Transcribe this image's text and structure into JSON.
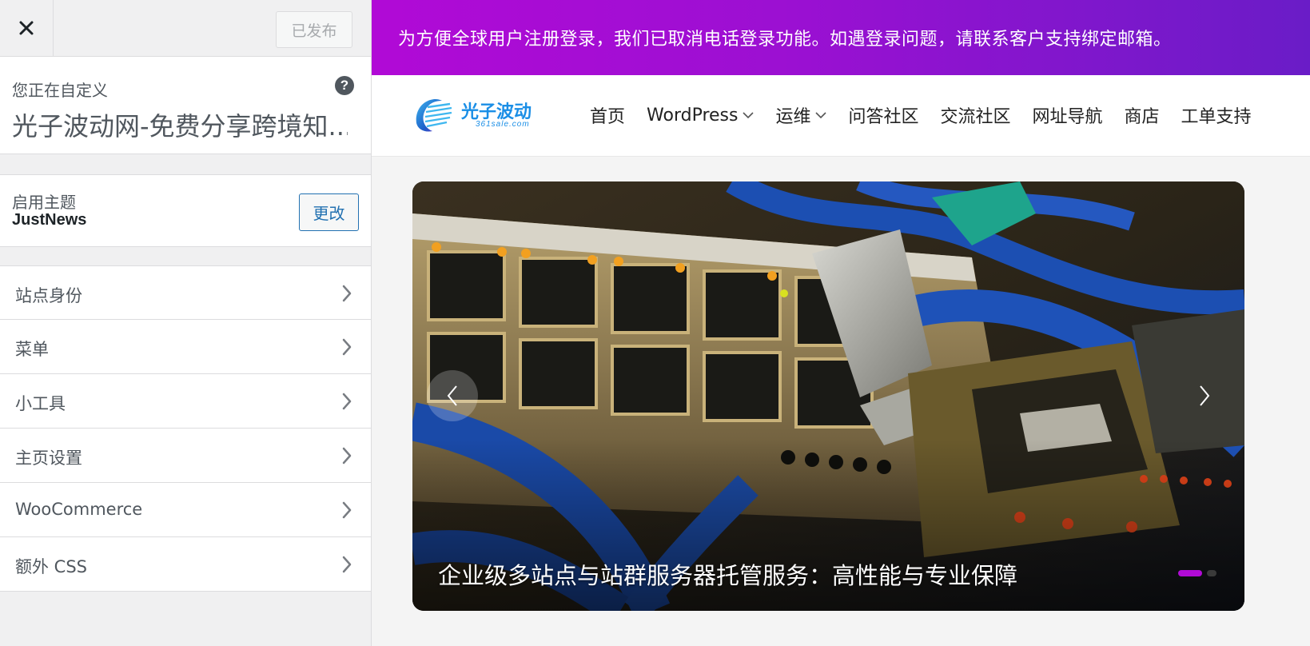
{
  "sidebar": {
    "publish_label": "已发布",
    "customizing_label": "您正在自定义",
    "site_title": "光子波动网-免费分享跨境知...",
    "active_theme_label": "启用主题",
    "active_theme_name": "JustNews",
    "change_label": "更改",
    "items": [
      {
        "label": "站点身份"
      },
      {
        "label": "菜单"
      },
      {
        "label": "小工具"
      },
      {
        "label": "主页设置"
      },
      {
        "label": "WooCommerce"
      },
      {
        "label": "额外 CSS"
      }
    ]
  },
  "preview": {
    "notice_text": "为方便全球用户注册登录，我们已取消电话登录功能。如遇登录问题，请联系客户支持绑定邮箱。",
    "logo_text": "光子波动",
    "logo_subtext": "361sale.com",
    "nav": [
      {
        "label": "首页",
        "has_dropdown": false
      },
      {
        "label": "WordPress",
        "has_dropdown": true
      },
      {
        "label": "运维",
        "has_dropdown": true
      },
      {
        "label": "问答社区",
        "has_dropdown": false
      },
      {
        "label": "交流社区",
        "has_dropdown": false
      },
      {
        "label": "网址导航",
        "has_dropdown": false
      },
      {
        "label": "商店",
        "has_dropdown": false
      },
      {
        "label": "工单支持",
        "has_dropdown": false
      }
    ],
    "slide_caption": "企业级多站点与站群服务器托管服务：高性能与专业保障",
    "slide_count": 2,
    "active_slide": 1
  },
  "colors": {
    "notice_gradient_start": "#b10ad6",
    "notice_gradient_end": "#6a1cc7",
    "accent_blue": "#2271b1",
    "logo_blue": "#1a8ee6",
    "dot_active": "#b10ad6"
  }
}
